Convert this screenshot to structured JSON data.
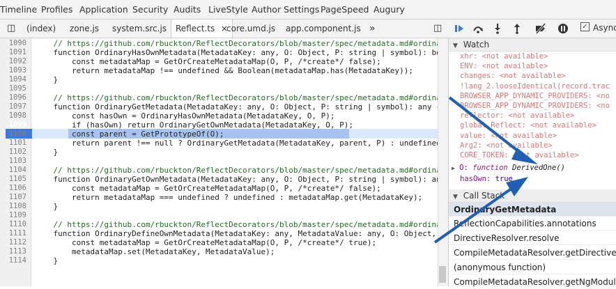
{
  "panel_tabs": [
    "Timeline",
    "Profiles",
    "Application",
    "Security",
    "Audits",
    "LiveStyle",
    "Author Settings",
    "PageSpeed",
    "Augury"
  ],
  "file_tabs": [
    "(index)",
    "zone.js",
    "system.src.js",
    "Reflect.ts",
    "core.umd.js",
    "app.component.js"
  ],
  "more_tabs_icon": "»",
  "close_tab_icon": "×",
  "code_lines": [
    {
      "n": "1090",
      "t": "    // https://github.com/rbuckton/ReflectDecorators/blob/master/spec/metadata.md#ordina",
      "c": "comment"
    },
    {
      "n": "1091",
      "t": "    function OrdinaryHasOwnMetadata(MetadataKey: any, O: Object, P: string | symbol): bo",
      "c": ""
    },
    {
      "n": "1092",
      "t": "        const metadataMap = GetOrCreateMetadataMap(O, P, /*create*/ false);",
      "c": ""
    },
    {
      "n": "1093",
      "t": "        return metadataMap !== undefined && Boolean(metadataMap.has(MetadataKey));",
      "c": ""
    },
    {
      "n": "1094",
      "t": "    }",
      "c": ""
    },
    {
      "n": "1095",
      "t": "",
      "c": ""
    },
    {
      "n": "1096",
      "t": "    // https://github.com/rbuckton/ReflectDecorators/blob/master/spec/metadata.md#ordina",
      "c": "comment"
    },
    {
      "n": "1097",
      "t": "    function OrdinaryGetMetadata(MetadataKey: any, O: Object, P: string | symbol): any {",
      "c": ""
    },
    {
      "n": "1098",
      "t": "        const hasOwn = OrdinaryHasOwnMetadata(MetadataKey, O, P);",
      "c": ""
    },
    {
      "n": "1099",
      "t": "        if (hasOwn) return OrdinaryGetOwnMetadata(MetadataKey, O, P);",
      "c": ""
    },
    {
      "n": "1100",
      "t": "        const parent = GetPrototypeOf(O);",
      "c": ""
    },
    {
      "n": "1101",
      "t": "        return parent !== null ? OrdinaryGetMetadata(MetadataKey, parent, P) : undefined",
      "c": ""
    },
    {
      "n": "1102",
      "t": "    }",
      "c": ""
    },
    {
      "n": "1103",
      "t": "",
      "c": ""
    },
    {
      "n": "1104",
      "t": "    // https://github.com/rbuckton/ReflectDecorators/blob/master/spec/metadata.md#ordina",
      "c": "comment"
    },
    {
      "n": "1105",
      "t": "    function OrdinaryGetOwnMetadata(MetadataKey: any, O: Object, P: string | symbol): an",
      "c": ""
    },
    {
      "n": "1106",
      "t": "        const metadataMap = GetOrCreateMetadataMap(O, P, /*create*/ false);",
      "c": ""
    },
    {
      "n": "1107",
      "t": "        return metadataMap === undefined ? undefined : metadataMap.get(MetadataKey);",
      "c": ""
    },
    {
      "n": "1108",
      "t": "    }",
      "c": ""
    },
    {
      "n": "1109",
      "t": "",
      "c": ""
    },
    {
      "n": "1110",
      "t": "    // https://github.com/rbuckton/ReflectDecorators/blob/master/spec/metadata.md#ordina",
      "c": "comment"
    },
    {
      "n": "1111",
      "t": "    function OrdinaryDefineOwnMetadata(MetadataKey: any, MetadataValue: any, O: Object,",
      "c": ""
    },
    {
      "n": "1112",
      "t": "        const metadataMap = GetOrCreateMetadataMap(O, P, /*create*/ true);",
      "c": ""
    },
    {
      "n": "1113",
      "t": "        metadataMap.set(MetadataKey, MetadataValue);",
      "c": ""
    },
    {
      "n": "1114",
      "t": "    }",
      "c": ""
    }
  ],
  "paused_line": "1099",
  "async_label": "Async",
  "watch": {
    "title": "Watch",
    "items": [
      "xhr: <not available>",
      "ENV: <not available>",
      "changes: <not available>",
      "!lang_2.looseIdentical(record.trac",
      "BROWSER_APP_DYNAMIC_PROVIDERS: <no",
      "BROWSER_APP_DYNAMIC_PROVIDERS: <no",
      "reflector: <not available>",
      "global.Reflect: <not available>",
      "value: <not available>",
      "Arg2: <not available>",
      "CORE_TOKEN: <not available>"
    ],
    "o_key": "O:",
    "o_kw": "function",
    "o_val": "DerivedOne()",
    "hasown_key": "hasOwn:",
    "hasown_val": "true"
  },
  "callstack": {
    "title": "Call Stack",
    "items": [
      "OrdinaryGetMetadata",
      "ReflectionCapabilities.annotations",
      "DirectiveResolver.resolve",
      "CompileMetadataResolver.getDirectiveMeta",
      "(anonymous function)",
      "CompileMetadataResolver.getNgModuleMet"
    ]
  },
  "colors": {
    "arrow": "#1f5fb4",
    "accent": "#3b7ae6",
    "comment": "#236e25",
    "keyword": "#aa0d91"
  }
}
